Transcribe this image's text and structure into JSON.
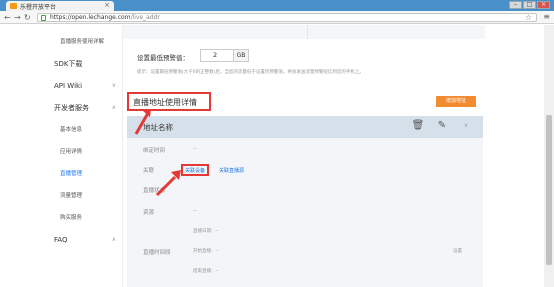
{
  "browser": {
    "tab_title": "乐橙开放平台",
    "tab_close": "×",
    "url_domain": "https://open.lechange.com",
    "url_path": "/live_addr",
    "win_minimize": "–",
    "win_maximize": "□",
    "win_close": "×"
  },
  "sidebar": {
    "items": [
      {
        "label": "直播服务使用详解",
        "level": 2,
        "active": false,
        "arrow": ""
      },
      {
        "label": "SDK下载",
        "level": 1,
        "active": false,
        "arrow": ""
      },
      {
        "label": "API Wiki",
        "level": 1,
        "active": false,
        "arrow": "∨"
      },
      {
        "label": "开发者服务",
        "level": 1,
        "active": false,
        "arrow": "∧"
      },
      {
        "label": "基本信息",
        "level": 2,
        "active": false,
        "arrow": ""
      },
      {
        "label": "应用详情",
        "level": 2,
        "active": false,
        "arrow": ""
      },
      {
        "label": "直播管理",
        "level": 2,
        "active": true,
        "arrow": ""
      },
      {
        "label": "流量管理",
        "level": 2,
        "active": false,
        "arrow": ""
      },
      {
        "label": "购买服务",
        "level": 2,
        "active": false,
        "arrow": ""
      },
      {
        "label": "FAQ",
        "level": 1,
        "active": false,
        "arrow": "∧"
      }
    ]
  },
  "threshold": {
    "label": "设置最低预警值：",
    "value": "2",
    "unit": "GB",
    "hint": "提示：设置最低预警值(大于0的正整数)后，当您的流量低于设置的预警值，将会发送流量预警短信到您的手机上。"
  },
  "section": {
    "title": "直播地址使用详情",
    "add_button": "增加地址"
  },
  "panel": {
    "head_title": "地址名称",
    "rows": {
      "bind_time": {
        "label": "绑定时间",
        "value": "--"
      },
      "relation": {
        "label": "关联",
        "link1": "关联设备",
        "link2": "关联直播源"
      },
      "live_status": {
        "label": "直播状态",
        "value": ""
      },
      "resource": {
        "label": "资源",
        "value": "--"
      },
      "record_time": {
        "label": "直播时间段",
        "line1": "直播日期：--",
        "line2": "开始直播：--",
        "line3": "结束直播：--",
        "action": "设置"
      }
    }
  },
  "colors": {
    "accent": "#1a73e8",
    "annotation_red": "#e53935",
    "orange_button": "#f28b30"
  }
}
